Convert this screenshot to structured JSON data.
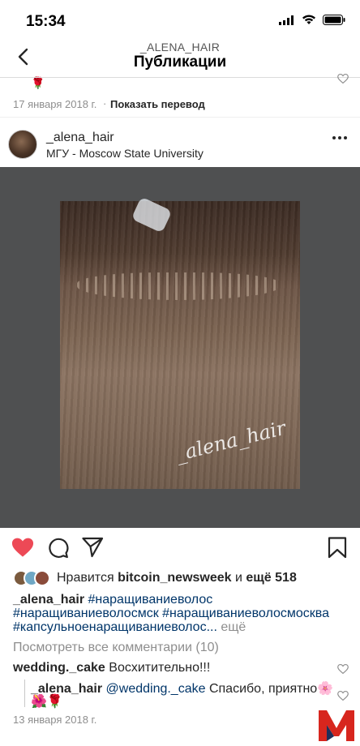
{
  "status_bar": {
    "time": "15:34"
  },
  "header": {
    "subtitle": "_ALENA_HAIR",
    "title": "Публикации"
  },
  "previous_post": {
    "date": "17 января 2018 г.",
    "separator": "·",
    "translate": "Показать перевод",
    "emoji": "🌹"
  },
  "post": {
    "username": "_alena_hair",
    "location": "МГУ - Moscow State University",
    "watermark": "_alena_hair",
    "likes": {
      "prefix": "Нравится",
      "user": "bitcoin_newsweek",
      "middle": "и",
      "count": "ещё 518"
    },
    "caption": {
      "author": "_alena_hair",
      "tag1": "#наращиваниеволос",
      "tag2": "#наращиваниеволосмск",
      "tag3": "#наращиваниеволосмосква",
      "tag4": "#капсульноенаращиваниеволос...",
      "more": "ещё"
    },
    "view_all_comments": "Посмотреть все комментарии (10)",
    "comments": [
      {
        "user": "wedding._cake",
        "text": "Восхитительно!!!"
      },
      {
        "user": "_alena_hair",
        "mention": "@wedding._cake",
        "text": "Спасибо, приятно🌸",
        "emoji": "🌺🌹"
      }
    ],
    "date": "13 января 2018 г."
  },
  "colors": {
    "like_red": "#ed4956",
    "text": "#262626",
    "muted": "#8e8e8e",
    "hashtag": "#003569",
    "logo_red": "#d7261e",
    "logo_navy": "#1f2f5a"
  }
}
